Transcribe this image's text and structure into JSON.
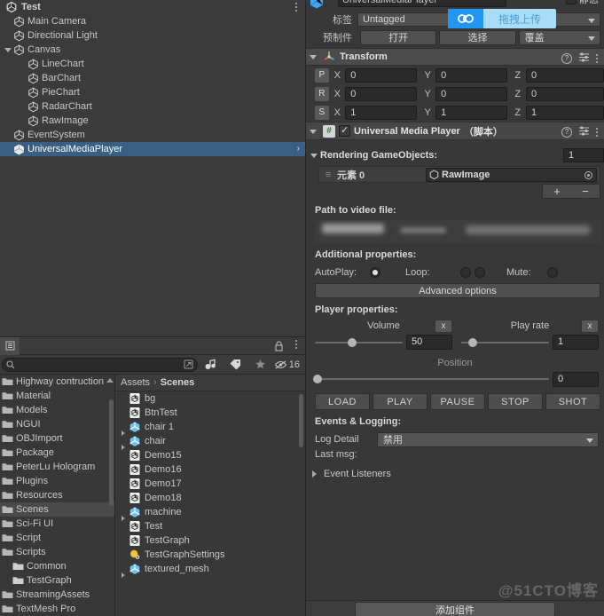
{
  "hierarchy": {
    "scene_name": "Test",
    "menu_icon": "kebab-menu-icon",
    "items": [
      {
        "label": "Main Camera",
        "depth": 1,
        "fold": "none",
        "selected": false
      },
      {
        "label": "Directional Light",
        "depth": 1,
        "fold": "none",
        "selected": false
      },
      {
        "label": "Canvas",
        "depth": 1,
        "fold": "open",
        "selected": false
      },
      {
        "label": "LineChart",
        "depth": 2,
        "fold": "none",
        "selected": false
      },
      {
        "label": "BarChart",
        "depth": 2,
        "fold": "none",
        "selected": false
      },
      {
        "label": "PieChart",
        "depth": 2,
        "fold": "none",
        "selected": false
      },
      {
        "label": "RadarChart",
        "depth": 2,
        "fold": "none",
        "selected": false
      },
      {
        "label": "RawImage",
        "depth": 2,
        "fold": "none",
        "selected": false
      },
      {
        "label": "EventSystem",
        "depth": 1,
        "fold": "none",
        "selected": false
      },
      {
        "label": "UniversalMediaPlayer",
        "depth": 1,
        "fold": "none",
        "selected": true
      }
    ],
    "selected_chevron": "›"
  },
  "project": {
    "search_placeholder": "",
    "search_value": "",
    "filter_count": "16",
    "lock_icon": "lock-icon",
    "menu_icon": "kebab-menu-icon",
    "toolbar_icons": [
      "search-icon",
      "type-filter-icon",
      "label-filter-icon",
      "favorite-star-icon",
      "hidden-eye-icon"
    ],
    "breadcrumb": {
      "root": "Assets",
      "separator": "›",
      "current": "Scenes"
    },
    "folders": [
      {
        "label": "Highway contruction",
        "kind": "folder",
        "indent": 0,
        "selected": false,
        "expandable": false
      },
      {
        "label": "Material",
        "kind": "folder",
        "indent": 0,
        "selected": false,
        "expandable": false
      },
      {
        "label": "Models",
        "kind": "folder",
        "indent": 0,
        "selected": false,
        "expandable": false
      },
      {
        "label": "NGUI",
        "kind": "folder",
        "indent": 0,
        "selected": false,
        "expandable": false
      },
      {
        "label": "OBJImport",
        "kind": "folder",
        "indent": 0,
        "selected": false,
        "expandable": false
      },
      {
        "label": "Package",
        "kind": "folder",
        "indent": 0,
        "selected": false,
        "expandable": false
      },
      {
        "label": "PeterLu Hologram",
        "kind": "folder",
        "indent": 0,
        "selected": false,
        "expandable": false
      },
      {
        "label": "Plugins",
        "kind": "folder",
        "indent": 0,
        "selected": false,
        "expandable": false
      },
      {
        "label": "Resources",
        "kind": "folder",
        "indent": 0,
        "selected": false,
        "expandable": false
      },
      {
        "label": "Scenes",
        "kind": "folder",
        "indent": 0,
        "selected": true,
        "expandable": false
      },
      {
        "label": "Sci-Fi UI",
        "kind": "folder",
        "indent": 0,
        "selected": false,
        "expandable": false
      },
      {
        "label": "Script",
        "kind": "folder",
        "indent": 0,
        "selected": false,
        "expandable": false
      },
      {
        "label": "Scripts",
        "kind": "folder",
        "indent": 0,
        "selected": false,
        "expandable": true
      },
      {
        "label": "Common",
        "kind": "subfolder",
        "indent": 1,
        "selected": false,
        "expandable": false
      },
      {
        "label": "TestGraph",
        "kind": "subfolder",
        "indent": 1,
        "selected": false,
        "expandable": false
      },
      {
        "label": "StreamingAssets",
        "kind": "folder",
        "indent": 0,
        "selected": false,
        "expandable": false
      },
      {
        "label": "TextMesh Pro",
        "kind": "folder",
        "indent": 0,
        "selected": false,
        "expandable": false
      }
    ],
    "files": [
      {
        "label": "bg",
        "icon": "scene-icon",
        "expandable": false
      },
      {
        "label": "BtnTest",
        "icon": "scene-icon",
        "expandable": false
      },
      {
        "label": "chair 1",
        "icon": "prefab-icon",
        "expandable": true
      },
      {
        "label": "chair",
        "icon": "prefab-icon",
        "expandable": true
      },
      {
        "label": "Demo15",
        "icon": "scene-icon",
        "expandable": false
      },
      {
        "label": "Demo16",
        "icon": "scene-icon",
        "expandable": false
      },
      {
        "label": "Demo17",
        "icon": "scene-icon",
        "expandable": false
      },
      {
        "label": "Demo18",
        "icon": "scene-icon",
        "expandable": false
      },
      {
        "label": "machine",
        "icon": "prefab-icon",
        "expandable": true
      },
      {
        "label": "Test",
        "icon": "scene-icon",
        "expandable": false
      },
      {
        "label": "TestGraph",
        "icon": "scene-icon",
        "expandable": false
      },
      {
        "label": "TestGraphSettings",
        "icon": "asset-icon",
        "expandable": false
      },
      {
        "label": "textured_mesh",
        "icon": "prefab-icon",
        "expandable": true
      }
    ]
  },
  "inspector": {
    "object_name": "UniversalMediaPlayer",
    "static_label": "静态",
    "tag_label": "标签",
    "tag_value": "Untagged",
    "prefab_label": "预制件",
    "prefab_open": "打开",
    "prefab_select": "选择",
    "prefab_override": "覆盖",
    "upload_overlay": {
      "text": "拖拽上传",
      "icon": "cloud-upload-icon",
      "bg": "#a8dcf7",
      "icon_bg": "#2196f3"
    },
    "transform": {
      "title": "Transform",
      "icons": [
        "help-icon",
        "preset-icon",
        "kebab-menu-icon"
      ],
      "rows": [
        {
          "badge": "P",
          "x": "0",
          "y": "0",
          "z": "0"
        },
        {
          "badge": "R",
          "x": "0",
          "y": "0",
          "z": "0"
        },
        {
          "badge": "S",
          "x": "1",
          "y": "1",
          "z": "1"
        }
      ],
      "axis_labels": {
        "x": "X",
        "y": "Y",
        "z": "Z"
      }
    },
    "ump": {
      "title": "Universal Media Player",
      "script_suffix": "（脚本）",
      "enabled": true,
      "icons": [
        "help-icon",
        "preset-icon",
        "kebab-menu-icon"
      ],
      "rendering_label": "Rendering GameObjects:",
      "rendering_count": "1",
      "element_label": "元素 0",
      "element_value": "RawImage",
      "add_btn": "+",
      "remove_btn": "−",
      "path_label": "Path to video file:",
      "path_value": "",
      "additional_label": "Additional properties:",
      "autoplay_label": "AutoPlay:",
      "autoplay_on": true,
      "loop_label": "Loop:",
      "loop_a_on": false,
      "loop_b_on": false,
      "mute_label": "Mute:",
      "mute_on": false,
      "advanced_btn": "Advanced options",
      "player_label": "Player properties:",
      "volume_label": "Volume",
      "volume_value": "50",
      "volume_pct": 42,
      "volume_reset": "x",
      "playrate_label": "Play rate",
      "playrate_value": "1",
      "playrate_pct": 13,
      "playrate_reset": "x",
      "position_label": "Position",
      "position_value": "0",
      "position_pct": 1,
      "transport": [
        "LOAD",
        "PLAY",
        "PAUSE",
        "STOP",
        "SHOT"
      ],
      "events_label": "Events & Logging:",
      "log_detail_label": "Log Detail",
      "log_detail_value": "禁用",
      "last_msg_label": "Last msg:",
      "event_listeners_label": "Event Listeners"
    },
    "watermark": "@51CTO博客",
    "add_component": "添加组件"
  }
}
